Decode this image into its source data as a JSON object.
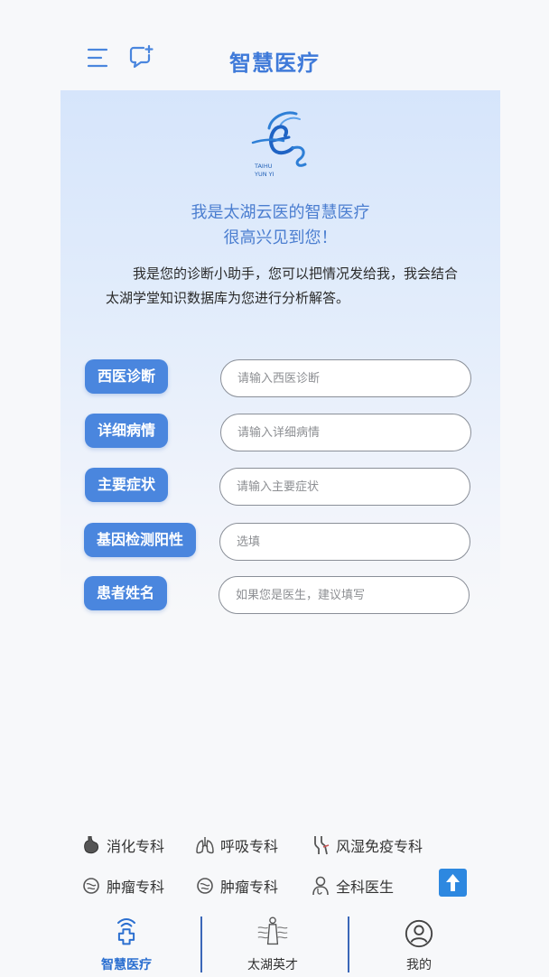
{
  "header": {
    "title": "智慧医疗",
    "menu_icon": "menu-icon",
    "chat_icon": "chat-add-icon"
  },
  "card": {
    "logo_text_line1": "TAIHU",
    "logo_text_line2": "YUN YI",
    "greeting_line1": "我是太湖云医的智慧医疗",
    "greeting_line2": "很高兴见到您！",
    "intro": "我是您的诊断小助手，您可以把情况发给我，我会结合太湖学堂知识数据库为您进行分析解答。"
  },
  "form": {
    "fields": [
      {
        "label": "西医诊断",
        "placeholder": "请输入西医诊断",
        "value": ""
      },
      {
        "label": "详细病情",
        "placeholder": "请输入详细病情",
        "value": ""
      },
      {
        "label": "主要症状",
        "placeholder": "请输入主要症状",
        "value": ""
      },
      {
        "label": "基因检测阳性",
        "placeholder": "选填",
        "value": ""
      },
      {
        "label": "患者姓名",
        "placeholder": "如果您是医生，建议填写",
        "value": ""
      }
    ]
  },
  "departments": [
    {
      "label": "消化专科",
      "icon": "stomach-icon"
    },
    {
      "label": "呼吸专科",
      "icon": "lungs-icon"
    },
    {
      "label": "风湿免疫专科",
      "icon": "joint-icon"
    },
    {
      "label": "肿瘤专科",
      "icon": "tumor-icon"
    },
    {
      "label": "肿瘤专科",
      "icon": "tumor-icon"
    },
    {
      "label": "全科医生",
      "icon": "doctor-icon"
    }
  ],
  "scroll_top_icon": "arrow-up-icon",
  "tabbar": {
    "tabs": [
      {
        "label": "智慧医疗",
        "icon": "medical-signal-icon",
        "active": true
      },
      {
        "label": "太湖英才",
        "icon": "talent-figure-icon",
        "active": false
      },
      {
        "label": "我的",
        "icon": "user-circle-icon",
        "active": false
      }
    ]
  },
  "colors": {
    "accent": "#4a86de",
    "title": "#3f7ad9",
    "greeting": "#4b7ed0",
    "tab_active": "#2b6fd0",
    "divider": "#3b67b8"
  }
}
